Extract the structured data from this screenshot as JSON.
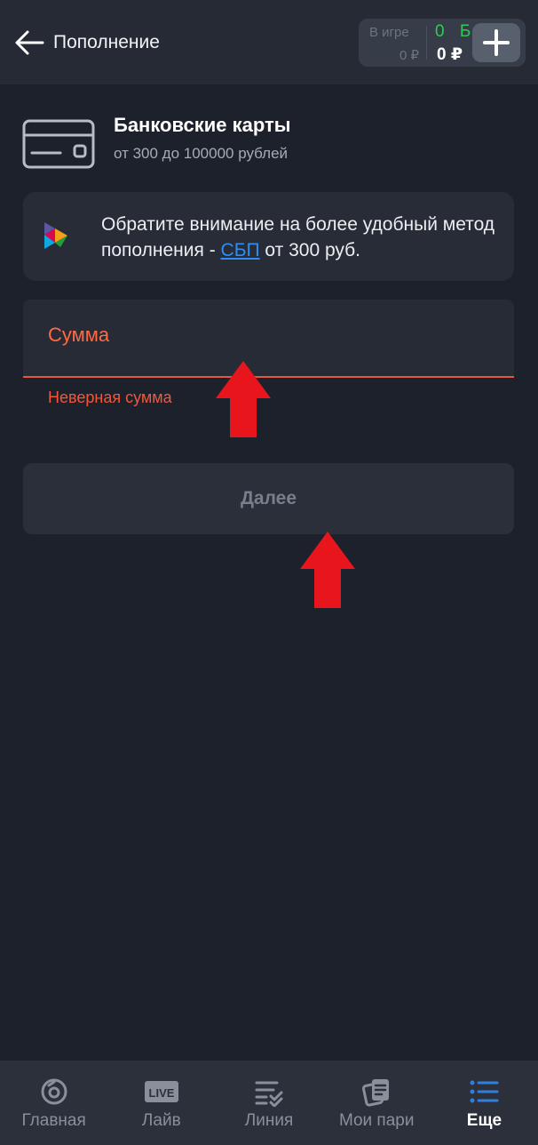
{
  "header": {
    "title": "Пополнение",
    "balance": {
      "label": "В игре",
      "ingame": "0 ₽",
      "bonus": "0 Б",
      "main": "0 ₽"
    }
  },
  "method": {
    "title": "Банковские карты",
    "range": "от 300 до 100000 рублей",
    "icon": "credit-card-icon"
  },
  "notice": {
    "text_before": "Обратите внимание на более удобный метод пополнения - ",
    "link": "СБП",
    "text_after": " от 300 руб.",
    "icon": "sbp-logo-icon"
  },
  "form": {
    "amount_placeholder": "Сумма",
    "amount_value": "",
    "error": "Неверная сумма",
    "next_label": "Далее"
  },
  "nav": {
    "items": [
      {
        "label": "Главная",
        "icon": "home-icon"
      },
      {
        "label": "Лайв",
        "icon": "live-icon",
        "badge": "LIVE"
      },
      {
        "label": "Линия",
        "icon": "list-check-icon"
      },
      {
        "label": "Мои пари",
        "icon": "bets-icon"
      },
      {
        "label": "Еще",
        "icon": "menu-icon",
        "active": true
      }
    ]
  },
  "colors": {
    "background": "#1c212b",
    "header": "#252a35",
    "error": "#f0583b",
    "bonus": "#2ecc53",
    "link": "#2e8ef5",
    "active_nav": "#2e7fe0",
    "arrow": "#e8161c"
  }
}
